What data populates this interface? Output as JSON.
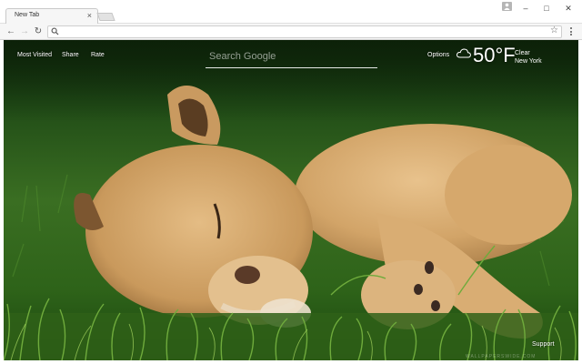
{
  "browser": {
    "tab_title": "New Tab",
    "tab_close": "×",
    "window_controls": {
      "minimize": "–",
      "maximize": "□",
      "close": "✕"
    },
    "nav": {
      "back": "←",
      "forward": "→",
      "reload": "↻"
    },
    "omnibox_value": "",
    "star_glyph": "☆",
    "icons": [
      "search-icon",
      "star-icon",
      "menu-icon",
      "profile-icon"
    ]
  },
  "newtab": {
    "links": {
      "most_visited": "Most Visited",
      "share": "Share",
      "rate": "Rate"
    },
    "search_placeholder": "Search Google",
    "options": "Options",
    "weather": {
      "temperature": "50°",
      "unit": "F",
      "condition": "Clear",
      "location": "New York"
    },
    "support": "Support",
    "watermark": "WALLPAPERSWIDE.COM"
  },
  "colors": {
    "fur": "#d9ad78",
    "grass": "#3a6e22",
    "chrome": "#f6f6f6",
    "text_light": "#ffffff"
  }
}
